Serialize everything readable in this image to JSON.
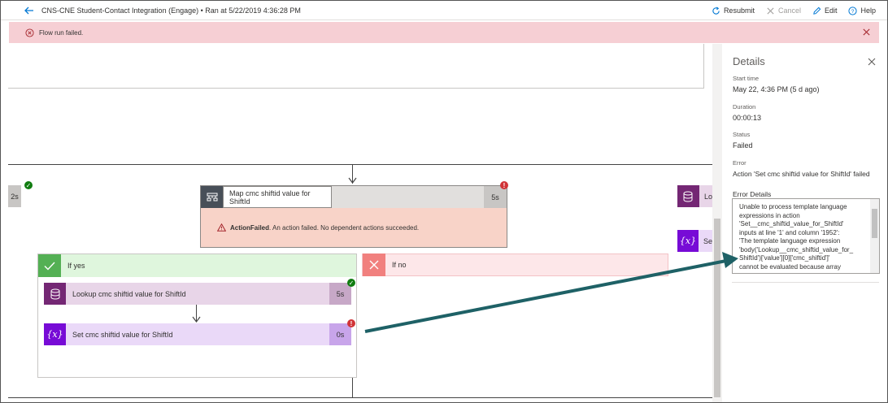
{
  "header": {
    "title": "CNS-CNE Student-Contact Integration (Engage) • Ran at 5/22/2019 4:36:28 PM",
    "resubmit_label": "Resubmit",
    "cancel_label": "Cancel",
    "edit_label": "Edit",
    "help_label": "Help"
  },
  "banner": {
    "message": "Flow run failed."
  },
  "flow": {
    "left_stub_duration": "2s",
    "map_action": {
      "title": "Map cmc shiftid value for ShiftId",
      "duration": "5s",
      "error_label": "ActionFailed",
      "error_text": ". An action failed. No dependent actions succeeded."
    },
    "if_yes": {
      "label": "If yes",
      "lookup": {
        "title": "Lookup cmc shiftid value for ShiftId",
        "duration": "5s"
      },
      "set": {
        "title": "Set cmc shiftid value for ShiftId",
        "duration": "0s"
      }
    },
    "if_no": {
      "label": "If no"
    },
    "right_stub_lookup": "Lo",
    "right_stub_set": "Se",
    "colors": {
      "data_op": "#742774",
      "variable": "#770bd6",
      "control": "#484f58",
      "success": "#107c10",
      "error": "#d13438",
      "arrow": "#1e6166"
    }
  },
  "details": {
    "heading": "Details",
    "start_time_label": "Start time",
    "start_time_value": "May 22, 4:36 PM (5 d ago)",
    "duration_label": "Duration",
    "duration_value": "00:00:13",
    "status_label": "Status",
    "status_value": "Failed",
    "error_label": "Error",
    "error_value": "Action 'Set cmc shiftid value for ShiftId' failed",
    "error_details_label": "Error Details",
    "error_details_lines": [
      "Unable to process template language",
      "expressions in action",
      "'Set__cmc_shiftid_value_for_ShiftId'",
      "inputs at line '1' and column '1952':",
      "'The template language expression",
      "'body('Lookup__cmc_shiftid_value_for_",
      "ShiftId')['value'][0]['cmc_shiftid']'",
      "cannot be evaluated because array"
    ]
  }
}
